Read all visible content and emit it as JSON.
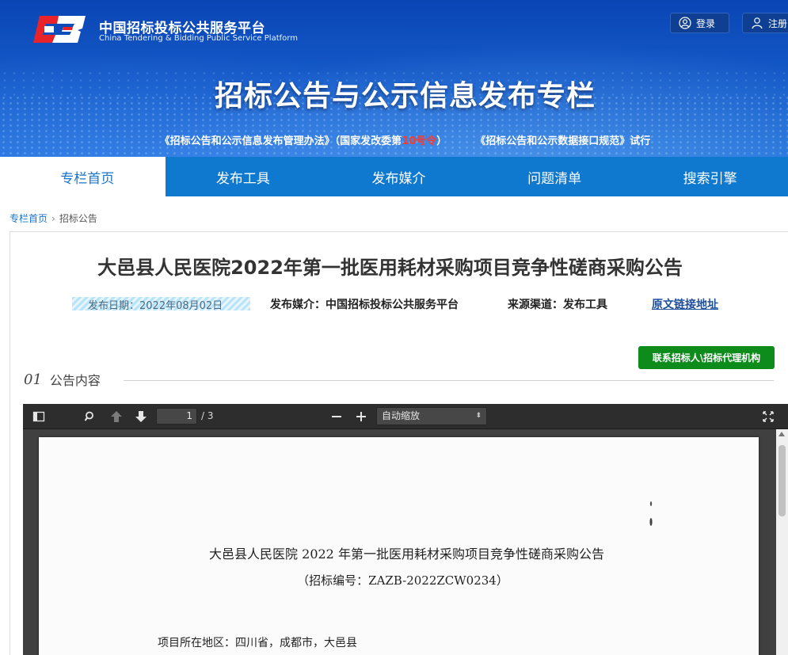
{
  "header": {
    "site_name": "中国招标投标公共服务平台",
    "site_name_en": "China Tendering & Bidding Public Service Platform",
    "login_label": "登录",
    "register_label": "注册",
    "banner_title": "招标公告与公示信息发布专栏",
    "link1_part1": "《招标公告和公示信息发布管理办法》（国家发改委第",
    "link1_number": "10号令",
    "link1_part2": "）",
    "link2": "《招标公告和公示数据接口规范》试行"
  },
  "nav": {
    "items": [
      "专栏首页",
      "发布工具",
      "发布媒介",
      "问题清单",
      "搜索引擎"
    ],
    "active_index": 0
  },
  "breadcrumb": {
    "home": "专栏首页",
    "current": "招标公告"
  },
  "notice": {
    "title": "大邑县人民医院2022年第一批医用耗材采购项目竞争性磋商采购公告",
    "publish_date": "发布日期：2022年08月02日",
    "media": "发布媒介：中国招标投标公共服务平台",
    "source": "来源渠道：发布工具",
    "original_link": "原文链接地址",
    "contact_button": "联系招标人\\招标代理机构",
    "section_number": "01",
    "section_label": "公告内容"
  },
  "pdf_viewer": {
    "current_page": "1",
    "total_pages": "/ 3",
    "zoom": "自动缩放",
    "page_title": "大邑县人民医院 2022 年第一批医用耗材采购项目竞争性磋商采购公告",
    "page_subtitle": "（招标编号：ZAZB-2022ZCW0234）",
    "page_region": "项目所在地区：四川省，成都市，大邑县"
  },
  "colors": {
    "nav_bg": "#0f78cf",
    "contact_button_bg": "#0d8c1c",
    "link_red": "#ff3a2a"
  }
}
